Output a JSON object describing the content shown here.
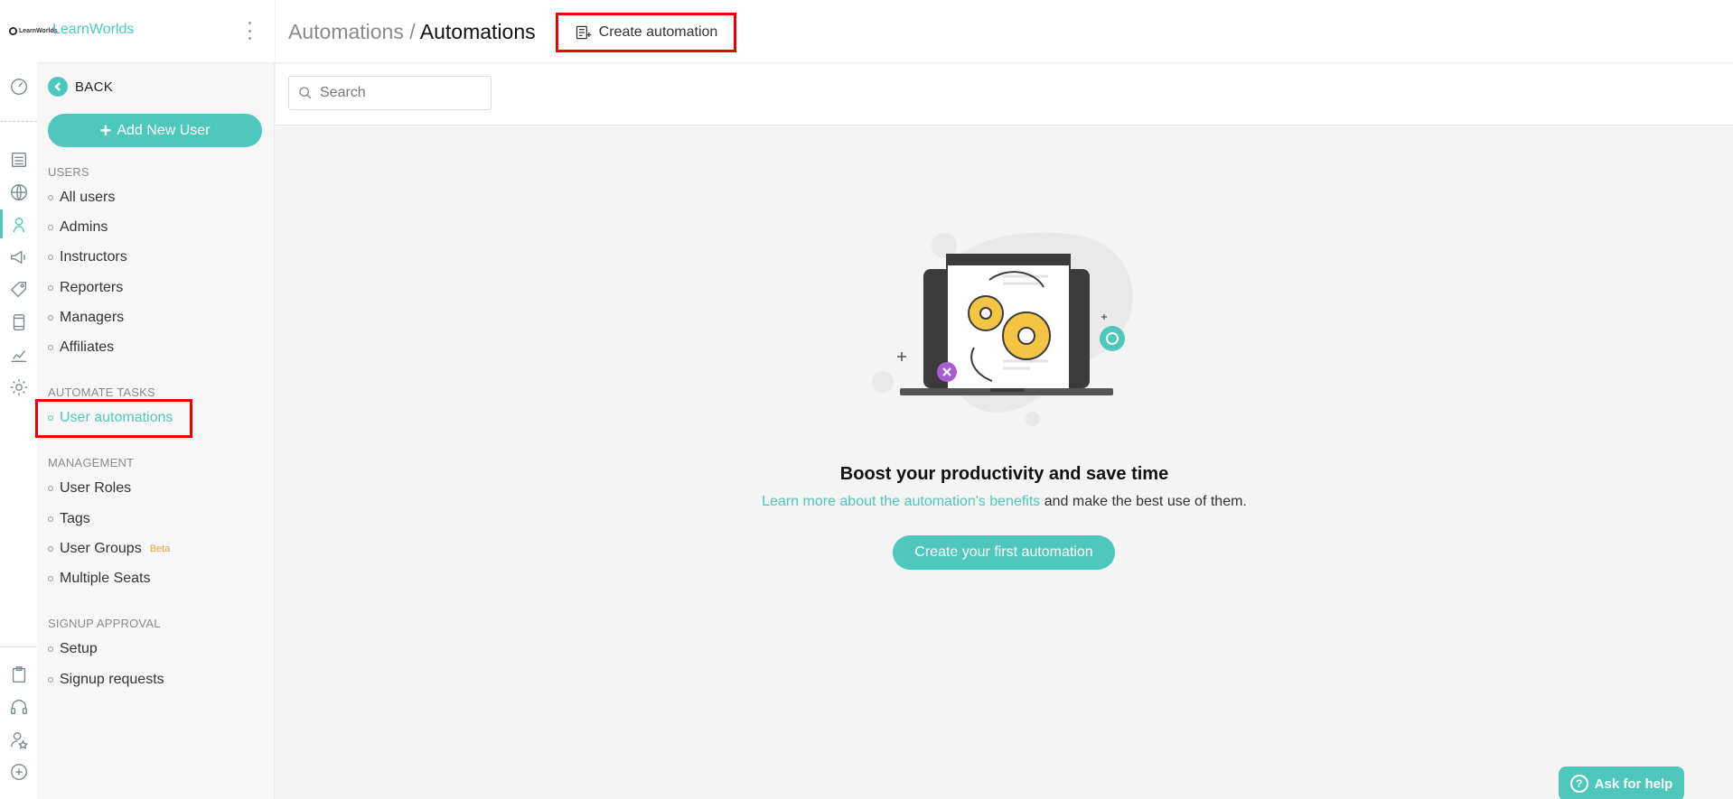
{
  "brand": {
    "small_label": "LearnWorlds",
    "name": "LearnWorlds"
  },
  "sidebar": {
    "back_label": "BACK",
    "add_user_label": "Add New User",
    "sections": {
      "users": "USERS",
      "automate": "AUTOMATE TASKS",
      "management": "MANAGEMENT",
      "signup": "SIGNUP APPROVAL"
    },
    "users_items": [
      "All users",
      "Admins",
      "Instructors",
      "Reporters",
      "Managers",
      "Affiliates"
    ],
    "automate_items": [
      "User automations"
    ],
    "management_items": [
      "User Roles",
      "Tags",
      "User Groups",
      "Multiple Seats"
    ],
    "beta_badge": "Beta",
    "signup_items": [
      "Setup",
      "Signup requests"
    ]
  },
  "header": {
    "crumb_parent": "Automations",
    "crumb_separator": " / ",
    "crumb_current": "Automations",
    "create_label": "Create automation"
  },
  "search": {
    "placeholder": "Search"
  },
  "empty_state": {
    "title": "Boost your productivity and save time",
    "link_text": "Learn more about the automation's benefits",
    "text_suffix": " and make the best use of them.",
    "cta_label": "Create your first automation"
  },
  "help": {
    "label": "Ask for help"
  },
  "colors": {
    "accent": "#4ec8bc",
    "highlight": "#ee0000",
    "beta": "#e8a23a"
  }
}
